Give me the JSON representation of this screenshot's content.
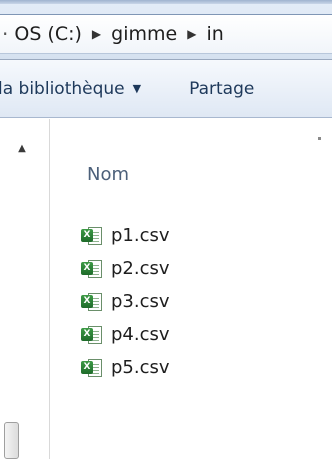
{
  "address_bar": {
    "crumbs": [
      "OS (C:)",
      "gimme",
      "in"
    ]
  },
  "toolbar": {
    "library_label": "la bibliothèque",
    "share_label": "Partage"
  },
  "file_list": {
    "column_header": "Nom",
    "files": [
      "p1.csv",
      "p2.csv",
      "p3.csv",
      "p4.csv",
      "p5.csv"
    ],
    "icon": "excel-csv-icon"
  }
}
